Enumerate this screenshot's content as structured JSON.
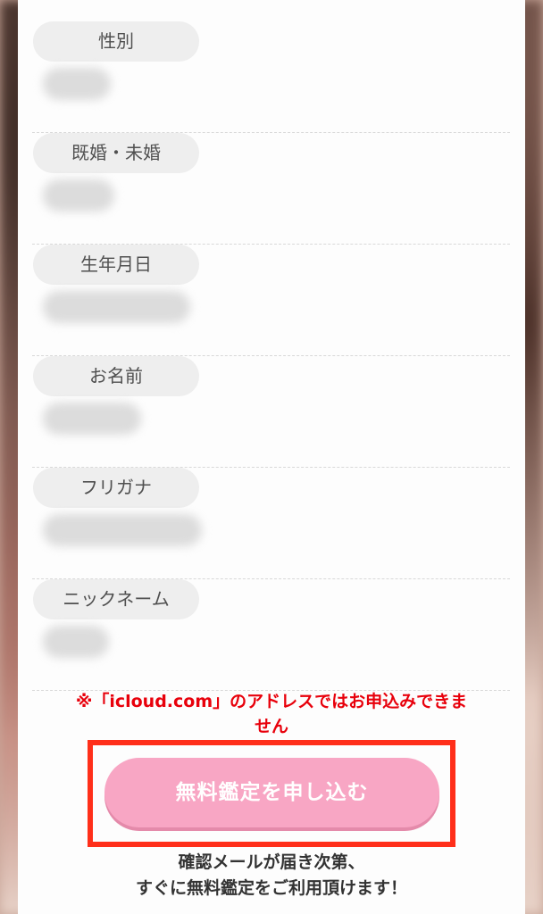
{
  "fields": [
    {
      "label": "性別"
    },
    {
      "label": "既婚・未婚"
    },
    {
      "label": "生年月日"
    },
    {
      "label": "お名前"
    },
    {
      "label": "フリガナ"
    },
    {
      "label": "ニックネーム"
    }
  ],
  "warning": {
    "line1": "※「icloud.com」のアドレスではお申込みできま",
    "line2": "せん"
  },
  "apply_button": {
    "label": "無料鑑定を申し込む"
  },
  "note": {
    "line1": "確認メールが届き次第、",
    "line2": "すぐに無料鑑定をご利用頂けます！"
  },
  "colors": {
    "warning": "#e8000b",
    "button": "#f8a6c4",
    "highlight_border": "#ff2f1a",
    "pill_bg": "#eeeeee"
  }
}
